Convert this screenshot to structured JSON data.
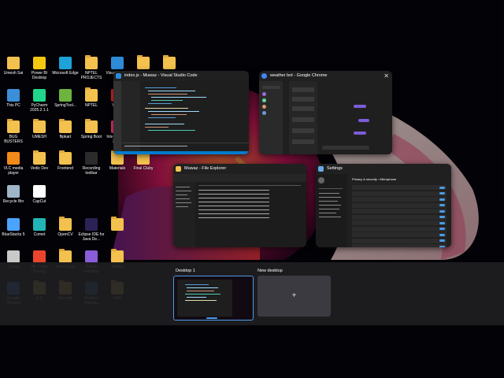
{
  "desktop_icons": [
    {
      "label": "Umesh Sai",
      "color": "#f2c14e",
      "kind": "user"
    },
    {
      "label": "Power BI Desktop",
      "color": "#f2c811",
      "kind": "app"
    },
    {
      "label": "Microsoft Edge",
      "color": "#1fa2d8",
      "kind": "app"
    },
    {
      "label": "NPTEL PROJECTS",
      "color": "#f2c14e",
      "kind": "folder"
    },
    {
      "label": "Visual Studio Co",
      "color": "#2f8bd6",
      "kind": "app"
    },
    {
      "label": "",
      "color": "#f2c14e",
      "kind": "folder"
    },
    {
      "label": "",
      "color": "#f2c14e",
      "kind": "folder"
    },
    {
      "label": "This PC",
      "color": "#3b8ed8",
      "kind": "app"
    },
    {
      "label": "PyCharm 2025.2.1.1",
      "color": "#21d789",
      "kind": "app"
    },
    {
      "label": "SpringTool...",
      "color": "#6db33f",
      "kind": "app"
    },
    {
      "label": "NPTEL",
      "color": "#f2c14e",
      "kind": "folder"
    },
    {
      "label": "Your...",
      "color": "#d9242a",
      "kind": "app"
    },
    {
      "label": "BUG BUSTERS",
      "color": "#f2c14e",
      "kind": "folder"
    },
    {
      "label": "UMESH",
      "color": "#f2c14e",
      "kind": "folder"
    },
    {
      "label": "flipkart",
      "color": "#f2c14e",
      "kind": "folder"
    },
    {
      "label": "Spring Boot",
      "color": "#f2c14e",
      "kind": "folder"
    },
    {
      "label": "IntelliJ IDEA 202...",
      "color": "#e8336e",
      "kind": "app"
    },
    {
      "label": "VLC media player",
      "color": "#f28a1a",
      "kind": "app"
    },
    {
      "label": "Vedic Dev",
      "color": "#f2c14e",
      "kind": "folder"
    },
    {
      "label": "Frontend",
      "color": "#f2c14e",
      "kind": "folder"
    },
    {
      "label": "Recording toolbar",
      "color": "#2b2b2b",
      "kind": "app"
    },
    {
      "label": "Materials",
      "color": "#f2c14e",
      "kind": "folder"
    },
    {
      "label": "Final Cluby",
      "color": "#f2c14e",
      "kind": "folder"
    },
    {
      "label": "Recycle Bin",
      "color": "#9fb6c9",
      "kind": "app"
    },
    {
      "label": "CapCut",
      "color": "#ffffff",
      "kind": "app"
    },
    {
      "label": "BlueStacks 5",
      "color": "#4aa3ff",
      "kind": "app"
    },
    {
      "label": "Comet",
      "color": "#23b5b5",
      "kind": "app"
    },
    {
      "label": "OpenCV",
      "color": "#f2c14e",
      "kind": "folder"
    },
    {
      "label": "Eclipse IDE for Java De...",
      "color": "#2c2255",
      "kind": "app"
    },
    {
      "label": "",
      "color": "#f2c14e",
      "kind": "folder"
    },
    {
      "label": "Cursor",
      "color": "#c9c9c9",
      "kind": "app"
    },
    {
      "label": "Hill Climb Racing",
      "color": "#e8452c",
      "kind": "app"
    },
    {
      "label": "Java Scope",
      "color": "#f2c14e",
      "kind": "folder"
    },
    {
      "label": "Github Desktop",
      "color": "#8a5cd8",
      "kind": "app"
    },
    {
      "label": "python",
      "color": "#f2c14e",
      "kind": "folder"
    },
    {
      "label": "Google Chrome",
      "color": "#4285f4",
      "kind": "app"
    },
    {
      "label": "A-Z",
      "color": "#f2c14e",
      "kind": "folder"
    },
    {
      "label": "leetcode",
      "color": "#f2c14e",
      "kind": "folder"
    },
    {
      "label": "DaVinci Resolve",
      "color": "#3c6fb0",
      "kind": "app"
    },
    {
      "label": "DSA",
      "color": "#f2c14e",
      "kind": "folder"
    }
  ],
  "windows": {
    "vscode": {
      "title": "index.js - Muwaz - Visual Studio Code",
      "icon": "vscode-icon",
      "color": "#2f8bd6"
    },
    "chrome": {
      "title": "weather bot - Google Chrome",
      "icon": "chrome-icon",
      "color": "#4285f4",
      "close": "✕"
    },
    "explorer": {
      "title": "Muwaz - File Explorer",
      "icon": "folder-icon",
      "color": "#f2c14e"
    },
    "settings": {
      "title": "Settings",
      "icon": "gear-icon",
      "color": "#6aa7e8",
      "section": "Privacy & security › Microphone"
    }
  },
  "desktops": {
    "desktop1": "Desktop 1",
    "new_desktop": "New desktop",
    "plus": "+"
  },
  "colors": {
    "accent": "#4c9be8",
    "bar": "#1e1e22"
  }
}
